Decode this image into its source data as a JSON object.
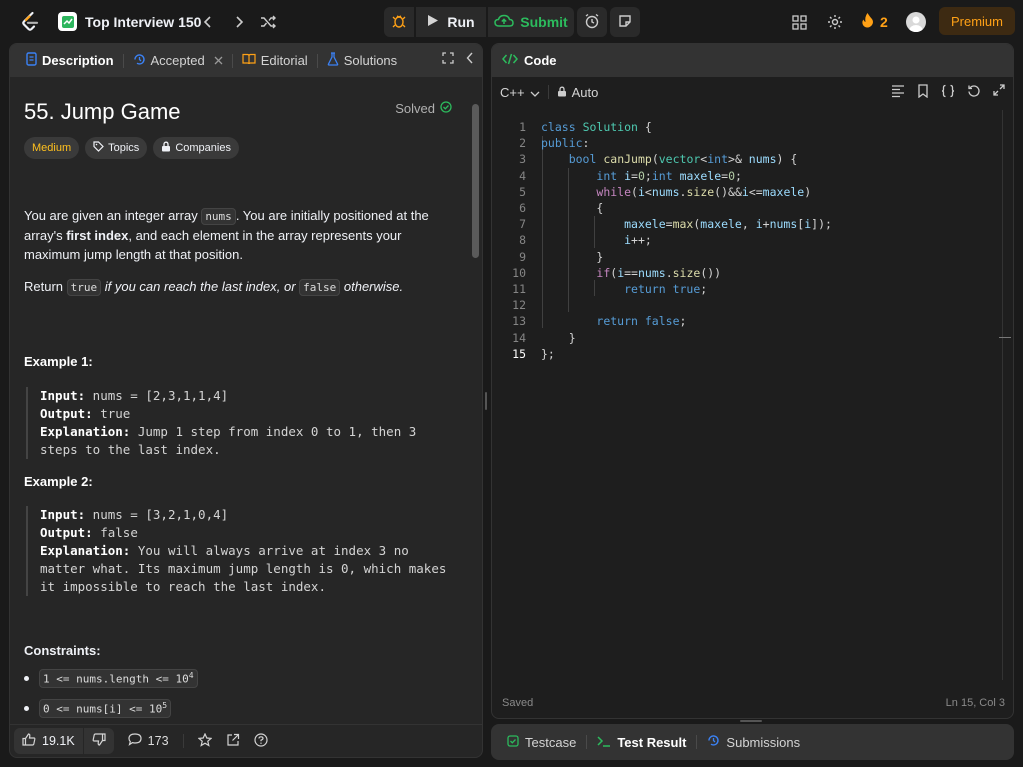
{
  "topbar": {
    "list_title": "Top Interview 150",
    "run_label": "Run",
    "submit_label": "Submit",
    "streak_count": "2",
    "premium_label": "Premium"
  },
  "left": {
    "tabs": [
      {
        "label": "Description"
      },
      {
        "label": "Accepted"
      },
      {
        "label": "Editorial"
      },
      {
        "label": "Solutions"
      }
    ],
    "title": "55. Jump Game",
    "solved_label": "Solved",
    "tags": {
      "difficulty": "Medium",
      "topics": "Topics",
      "companies": "Companies"
    },
    "description": {
      "p1_a": "You are given an integer array ",
      "p1_code": "nums",
      "p1_b": ". You are initially positioned at the array's ",
      "p1_bold": "first index",
      "p1_c": ", and each element in the array represents your maximum jump length at that position.",
      "p2_a": "Return ",
      "p2_true": "true",
      "p2_b": " if you can reach the last index, or ",
      "p2_false": "false",
      "p2_c": " otherwise."
    },
    "example1": {
      "heading": "Example 1:",
      "input_label": "Input:",
      "input": " nums = [2,3,1,1,4]",
      "output_label": "Output:",
      "output": " true",
      "expl_label": "Explanation:",
      "expl_1": " Jump 1 step from index 0 to 1, then 3",
      "expl_2": "steps to the last index."
    },
    "example2": {
      "heading": "Example 2:",
      "input_label": "Input:",
      "input": " nums = [3,2,1,0,4]",
      "output_label": "Output:",
      "output": " false",
      "expl_label": "Explanation:",
      "expl_1": " You will always arrive at index 3 no",
      "expl_2": "matter what. Its maximum jump length is 0, which makes",
      "expl_3": "it impossible to reach the last index."
    },
    "constraints": {
      "heading": "Constraints:",
      "c1": "1 <= nums.length <= 10",
      "c1_sup": "4",
      "c2": "0 <= nums[i] <= 10",
      "c2_sup": "5"
    },
    "footer": {
      "likes": "19.1K",
      "comments": "173"
    }
  },
  "right": {
    "header": "Code",
    "language": "C++",
    "auto_label": "Auto",
    "status_saved": "Saved",
    "cursor_pos": "Ln 15, Col 3",
    "code_lines": [
      "class Solution {",
      "public:",
      "    bool canJump(vector<int>& nums) {",
      "        int i=0;int maxele=0;",
      "        while(i<nums.size()&&i<=maxele)",
      "        {",
      "            maxele=max(maxele, i+nums[i]);",
      "            i++;",
      "        }",
      "        if(i==nums.size())",
      "            return true;",
      "",
      "        return false;",
      "    }",
      "};"
    ]
  },
  "bottom_tabs": [
    {
      "label": "Testcase"
    },
    {
      "label": "Test Result"
    },
    {
      "label": "Submissions"
    }
  ],
  "colors": {
    "accent": "#ffa116",
    "success": "#2cbb5d",
    "medium": "#ffc01e"
  }
}
